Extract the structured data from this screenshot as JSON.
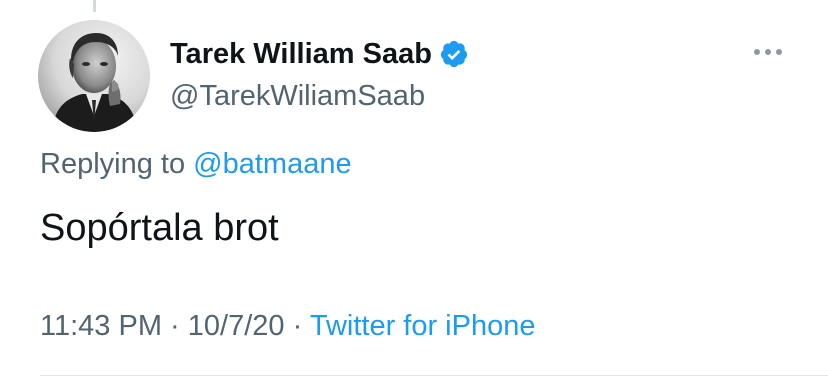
{
  "tweet": {
    "author": {
      "name": "Tarek William Saab",
      "handle": "@TarekWiliamSaab",
      "verified_icon": "verified-badge-icon"
    },
    "reply": {
      "prefix": "Replying to",
      "mention": "@batmaane"
    },
    "text": "Sopórtala brot",
    "meta": {
      "time": "11:43 PM",
      "separator1": "·",
      "date": "10/7/20",
      "separator2": "·",
      "source": "Twitter for iPhone"
    },
    "more_icon": "more-options-icon"
  },
  "colors": {
    "accent": "#1d9bf0",
    "text_primary": "#0f1419",
    "text_secondary": "#536471"
  }
}
